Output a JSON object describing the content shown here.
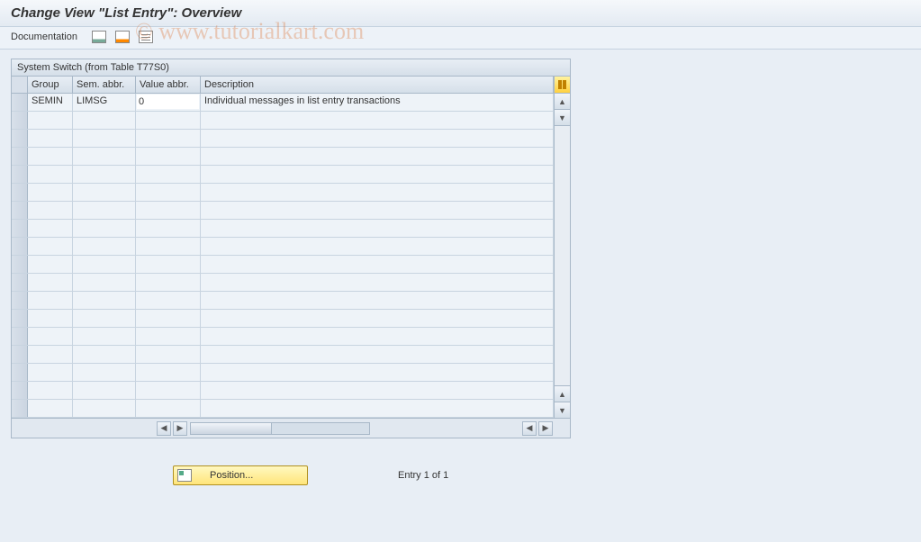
{
  "title": "Change View \"List Entry\": Overview",
  "toolbar": {
    "documentation_label": "Documentation"
  },
  "grid": {
    "title": "System Switch (from Table T77S0)",
    "headers": {
      "group": "Group",
      "sem_abbr": "Sem. abbr.",
      "value_abbr": "Value abbr.",
      "description": "Description"
    },
    "rows": [
      {
        "group": "SEMIN",
        "sem_abbr": "LIMSG",
        "value_abbr": "0",
        "description": "Individual messages in list entry transactions"
      }
    ]
  },
  "footer": {
    "position_label": "Position...",
    "entry_status": "Entry 1 of 1"
  },
  "watermark": "© www.tutorialkart.com"
}
